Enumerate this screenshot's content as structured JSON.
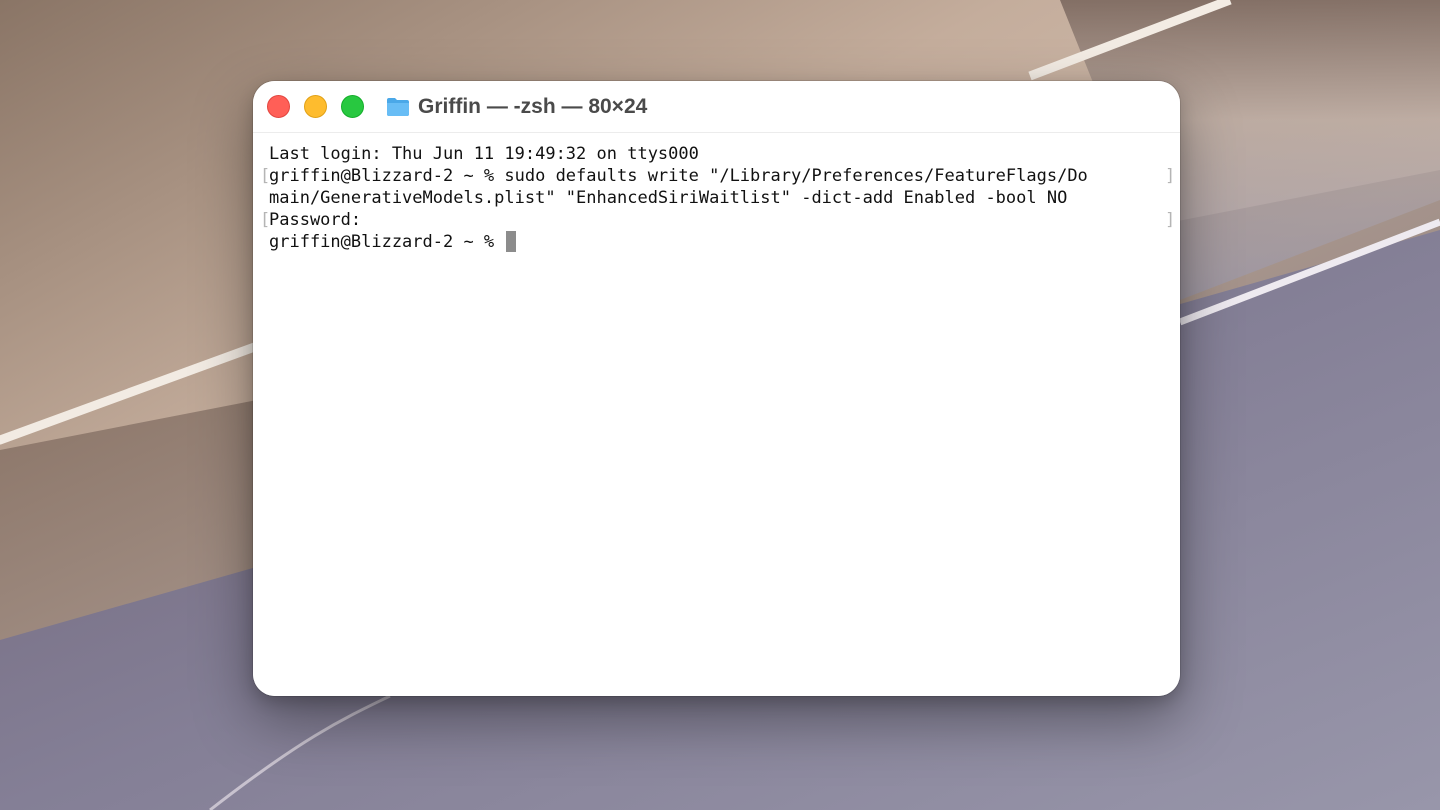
{
  "window": {
    "title": "Griffin — -zsh — 80×24",
    "folder_icon": "folder-icon",
    "traffic_lights": {
      "close_color": "#ff5f57",
      "minimize_color": "#febc2e",
      "zoom_color": "#28c840"
    }
  },
  "terminal": {
    "lines": [
      "Last login: Thu Jun 11 19:49:32 on ttys000",
      "griffin@Blizzard-2 ~ % sudo defaults write \"/Library/Preferences/FeatureFlags/Do",
      "main/GenerativeModels.plist\" \"EnhancedSiriWaitlist\" -dict-add Enabled -bool NO",
      "Password:",
      "griffin@Blizzard-2 ~ % "
    ],
    "mark_open": "[",
    "mark_close": "]"
  }
}
